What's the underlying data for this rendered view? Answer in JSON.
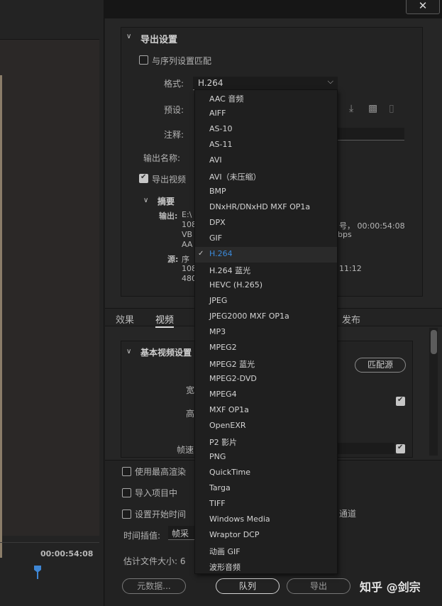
{
  "window": {
    "close_symbol": "✕"
  },
  "left": {
    "timecode": "00:00:54:08"
  },
  "export_settings": {
    "title": "导出设置",
    "match_sequence": "与序列设置匹配",
    "format_label": "格式:",
    "format_value": "H.264",
    "preset_label": "预设:",
    "comment_label": "注释:",
    "output_name_label": "输出名称:",
    "export_video": "导出视频",
    "summary_title": "摘要",
    "output_label": "输出:",
    "output_lines": [
      "E:\\",
      "108",
      "VB",
      "AA"
    ],
    "output_right": [
      "号，  00:00:54:08",
      "bps"
    ],
    "source_label": "源:",
    "source_lines": [
      "序",
      "108",
      "480"
    ],
    "source_right": "11:12"
  },
  "tabs": [
    {
      "label": "效果",
      "active": false
    },
    {
      "label": "视频",
      "active": true
    },
    {
      "label": "发布",
      "active": false
    }
  ],
  "video": {
    "basic_title": "基本视频设置",
    "width_label": "宽",
    "height_label": "高",
    "frame_rate_label": "帧速",
    "match_source": "匹配源"
  },
  "bottom": {
    "max_render_quality": "使用最高渲染",
    "import_into_project": "导入项目中",
    "set_start_timecode": "设置开始时间",
    "channel_suffix": "通道",
    "time_interp_label": "时间插值:",
    "time_interp_value": "帧采",
    "est_file_size": "估计文件大小:  6",
    "metadata_btn": "元数据...",
    "queue_btn": "队列",
    "export_btn": "导出"
  },
  "dropdown": {
    "items": [
      "AAC 音频",
      "AIFF",
      "AS-10",
      "AS-11",
      "AVI",
      "AVI（未压缩）",
      "BMP",
      "DNxHR/DNxHD MXF OP1a",
      "DPX",
      "GIF",
      "H.264",
      "H.264 蓝光",
      "HEVC (H.265)",
      "JPEG",
      "JPEG2000 MXF OP1a",
      "MP3",
      "MPEG2",
      "MPEG2 蓝光",
      "MPEG2-DVD",
      "MPEG4",
      "MXF OP1a",
      "OpenEXR",
      "P2 影片",
      "PNG",
      "QuickTime",
      "Targa",
      "TIFF",
      "Windows Media",
      "Wraptor DCP",
      "动画 GIF",
      "波形音频"
    ],
    "selected": "H.264",
    "check_symbol": "✓"
  },
  "watermark": "知乎 @剑宗",
  "colors": {
    "selected_item": "#3b89d9",
    "playhead": "#3e86d4"
  }
}
